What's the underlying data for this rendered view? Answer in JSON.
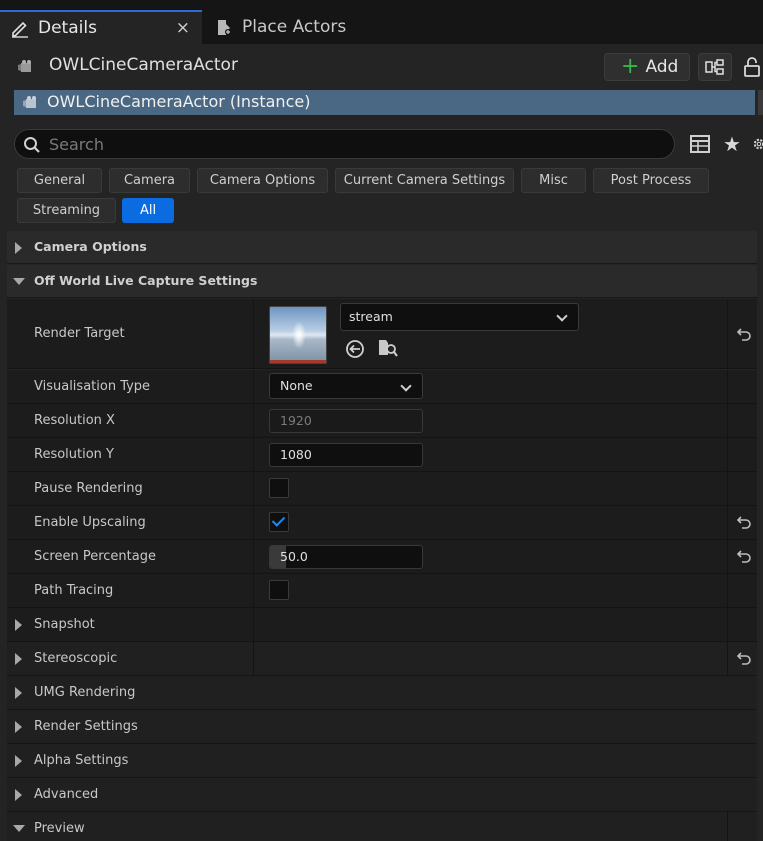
{
  "tabs": {
    "details": "Details",
    "place_actors": "Place Actors",
    "close_glyph": "×"
  },
  "actor": {
    "name": "OWLCineCameraActor",
    "add_label": "Add",
    "instance_label": "OWLCineCameraActor (Instance)"
  },
  "search": {
    "placeholder": "Search"
  },
  "filters": [
    "General",
    "Camera",
    "Camera Options",
    "Current Camera Settings",
    "Misc",
    "Post Process",
    "Streaming",
    "All"
  ],
  "active_filter": "All",
  "categories": {
    "camera_options": "Camera Options",
    "owl_capture": "Off World Live Capture Settings"
  },
  "properties": {
    "render_target": {
      "label": "Render Target",
      "value": "stream"
    },
    "visualisation_type": {
      "label": "Visualisation Type",
      "value": "None"
    },
    "resolution_x": {
      "label": "Resolution X",
      "value": "1920"
    },
    "resolution_y": {
      "label": "Resolution Y",
      "value": "1080"
    },
    "pause_rendering": {
      "label": "Pause Rendering",
      "checked": false
    },
    "enable_upscaling": {
      "label": "Enable Upscaling",
      "checked": true
    },
    "screen_percentage": {
      "label": "Screen Percentage",
      "value": "50.0"
    },
    "path_tracing": {
      "label": "Path Tracing",
      "checked": false
    }
  },
  "subgroups": {
    "snapshot": "Snapshot",
    "stereoscopic": "Stereoscopic",
    "umg_rendering": "UMG Rendering",
    "render_settings": "Render Settings",
    "alpha_settings": "Alpha Settings",
    "advanced": "Advanced",
    "preview": "Preview"
  },
  "colors": {
    "accent": "#0a6ce0",
    "instance_bg": "#4a6784",
    "add_plus": "#39b54a"
  }
}
